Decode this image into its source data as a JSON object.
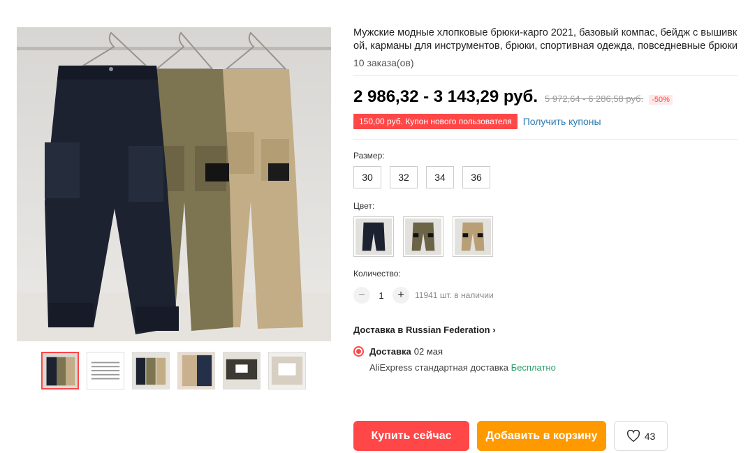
{
  "product": {
    "title": "Мужские модные хлопковые брюки-карго 2021, базовый компас, бейдж с вышивкой, карманы для инструментов, брюки, спортивная одежда, повседневные брюки",
    "orders": "10 заказа(ов)",
    "price": "2 986,32 - 3 143,29 руб.",
    "old_price": "5 972,64 - 6 286,58 руб.",
    "discount": "-50%"
  },
  "coupon": {
    "text": "150,00 руб. Купон нового пользователя",
    "link": "Получить купоны"
  },
  "size": {
    "label": "Размер:",
    "options": [
      "30",
      "32",
      "34",
      "36"
    ]
  },
  "color": {
    "label": "Цвет:",
    "options": [
      "black-pants",
      "olive-pants",
      "khaki-pants"
    ]
  },
  "quantity": {
    "label": "Количество:",
    "value": "1",
    "minus": "−",
    "plus": "+",
    "stock": "11941 шт. в наличии"
  },
  "shipping": {
    "title": "Доставка в Russian Federation",
    "chevron": "›",
    "name": "Доставка",
    "date": "02 мая",
    "method": "AliExpress стандартная доставка",
    "free": "Бесплатно"
  },
  "actions": {
    "buy": "Купить сейчас",
    "cart": "Добавить в корзину",
    "wish_count": "43"
  },
  "colors": {
    "accent": "#ff4747",
    "cart": "#ff9900",
    "link": "#2e7bb2",
    "free": "#2a9d6b",
    "black_pants": "#1c2230",
    "olive_pants": "#7d7552",
    "khaki_pants": "#c2ad86"
  }
}
